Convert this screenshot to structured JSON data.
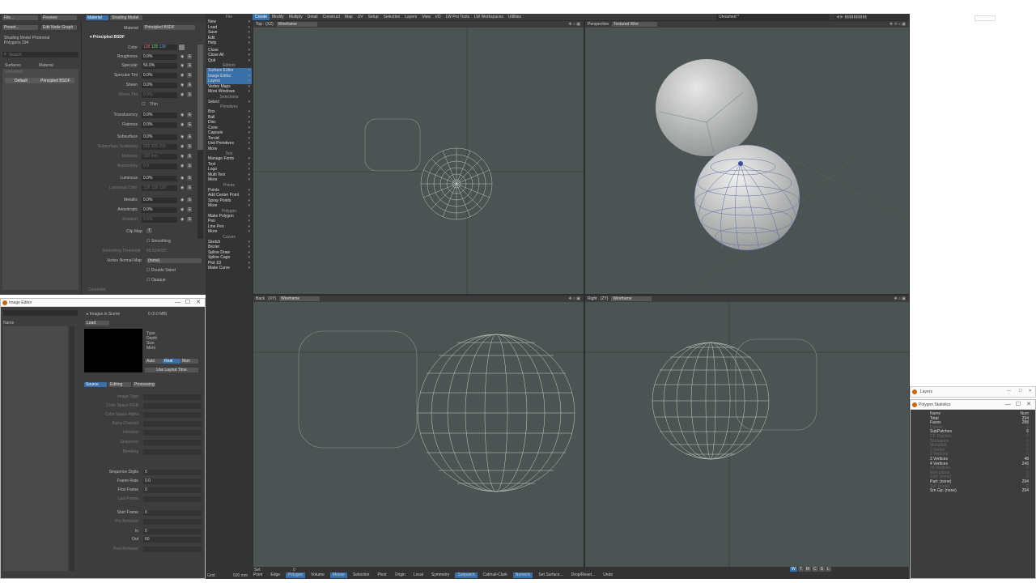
{
  "topbar": {
    "file_menu": "File...",
    "preview_menu": "Preview",
    "preset_menu": "Preset...",
    "edit_node_graph": "Edit Node Graph",
    "tab_material": "Material",
    "tab_shading": "Shading Model"
  },
  "surface_list": {
    "shading_model_label": "Shading Model",
    "shading_model_value": "Photoreal",
    "polygons_label": "Polygons",
    "polygons_value": "294",
    "search_placeholder": "Search",
    "col_surfaces": "Surfaces",
    "col_material": "Material",
    "group_name": "Unnamed",
    "row_surface": "Default",
    "row_material": "Principled BSDF"
  },
  "material": {
    "material_label": "Material",
    "material_value": "Principled BSDF",
    "section_title": "Principled BSDF",
    "color_label": "Color",
    "color_r": "128",
    "color_g": "128",
    "color_b": "128",
    "rows": [
      {
        "label": "Roughness",
        "value": "0.0%"
      },
      {
        "label": "Specular",
        "value": "50.0%"
      },
      {
        "label": "Specular Tint",
        "value": "0.0%"
      },
      {
        "label": "Sheen",
        "value": "0.0%"
      },
      {
        "label": "Sheen Tint",
        "value": "0.0%"
      },
      {
        "label": "Thin",
        "value": ""
      },
      {
        "label": "Translucency",
        "value": "0.0%"
      },
      {
        "label": "Flatness",
        "value": "0.0%"
      },
      {
        "label": "Subsurface",
        "value": "0.0%"
      },
      {
        "label": "Subsurface Scattering",
        "value": "255 255 255"
      },
      {
        "label": "Distance",
        "value": "100 mm"
      },
      {
        "label": "Asymmetry",
        "value": "0.0"
      },
      {
        "label": "Luminous",
        "value": "0.0%"
      },
      {
        "label": "Luminous Color",
        "value": "128 128 128"
      },
      {
        "label": "Metallic",
        "value": "0.0%"
      },
      {
        "label": "Anisotropic",
        "value": "0.0%"
      },
      {
        "label": "Rotation",
        "value": "0.0%"
      }
    ],
    "clip_map": "Clip Map",
    "clip_map_btn": "T",
    "smoothing": "Smoothing",
    "smoothing_threshold_label": "Smoothing Threshold",
    "smoothing_threshold_value": "89.524655°",
    "vertex_normal_label": "Vertex Normal Map",
    "vertex_normal_value": "(none)",
    "double_sided": "Double Sided",
    "opaque": "Opaque",
    "comment": "Comment"
  },
  "tool_menu": {
    "file_label": "File",
    "file_items": [
      "New",
      "Load",
      "Save",
      "Edit",
      "Help"
    ],
    "file_items2": [
      "Close",
      "Close All",
      "Quit"
    ],
    "editors_label": "Editors",
    "editor_items": [
      "Surface Editor",
      "Image Editor",
      "Layers",
      "Vertex Maps",
      "More Windows"
    ],
    "selections_label": "Selections",
    "select_item": "Select",
    "primitives_label": "Primitives",
    "primitive_items": [
      "Box",
      "Ball",
      "Disc",
      "Cone",
      "Capsule",
      "Toroid",
      "Unit Primitives",
      "More"
    ],
    "text_label": "Text",
    "text_items": [
      "Manage Fonts",
      "Text",
      "Logo",
      "Multi Text",
      "More"
    ],
    "points_label": "Points",
    "points_items": [
      "Points",
      "Add Center Point",
      "Spray Points",
      "More"
    ],
    "polygon_label": "Polygon",
    "polygon_items": [
      "Make Polygon",
      "Pen",
      "Line Pen",
      "More"
    ],
    "curves_label": "Curves",
    "curves_items": [
      "Sketch",
      "Bezier",
      "Spline Draw",
      "Spline Cage",
      "Plot 1D",
      "Make Curve"
    ]
  },
  "main_tabs": [
    "Create",
    "Modify",
    "Multiply",
    "Detail",
    "Construct",
    "Map",
    "UV",
    "Setup",
    "Selection",
    "Layers",
    "View",
    "I/O",
    "LW Pro Tools",
    "LW Workspaces",
    "Utilities"
  ],
  "object_name": "Unnamed *",
  "viewports": {
    "top": {
      "view": "Top",
      "axis": "(XZ)",
      "mode": "Wireframe"
    },
    "perspective": {
      "view": "Perspective",
      "mode": "Textured Wire"
    },
    "back": {
      "view": "Back",
      "axis": "(XY)",
      "mode": "Wireframe"
    },
    "right": {
      "view": "Right",
      "axis": "(ZY)",
      "mode": "Wireframe"
    }
  },
  "image_editor": {
    "title": "Image Editor",
    "images_in_scene": "Images in Scene",
    "memory": "0 (0.0 MB)",
    "col_name": "Name",
    "load_btn": "Load",
    "info_type": "Type",
    "info_depth": "Depth",
    "info_size": "Size",
    "info_mem": "Mem",
    "btn_auto": "Auto",
    "btn_real": "Real",
    "btn_man": "Man",
    "use_layout_time": "Use Layout Time",
    "tabs": [
      "Source",
      "Editing",
      "Processing"
    ],
    "fields": [
      "Image Type",
      "Color Space RGB",
      "Color Space Alpha",
      "Alpha Channel",
      "Interlace",
      "Sequence",
      "Blending",
      "Sequence Digits",
      "Frame Rate",
      "First Frame",
      "Last Frame",
      "Start Frame",
      "Pre Behavior",
      "In",
      "Out",
      "Post Behavior"
    ],
    "field_values": {
      "Sequence Digits": "0",
      "Frame Rate": "0.0",
      "First Frame": "0",
      "Start Frame": "0",
      "In": "0",
      "Out": "60"
    }
  },
  "layers_window": {
    "title": "Layers"
  },
  "poly_stats": {
    "title": "Polygon Statistics",
    "col_name": "Name",
    "col_num": "Num",
    "rows": [
      {
        "name": "Total",
        "num": "294",
        "hl": true
      },
      {
        "name": "Faces",
        "num": "288",
        "hl": true
      },
      {
        "name": "Curves",
        "num": "0",
        "hl": false
      },
      {
        "name": "SubPatches",
        "num": "6",
        "hl": true
      },
      {
        "name": "CC Patches",
        "num": "0",
        "hl": false
      },
      {
        "name": "Skelegons",
        "num": "0",
        "hl": false
      },
      {
        "name": "Metaballs",
        "num": "0",
        "hl": false
      },
      {
        "name": "1 Vertex",
        "num": "0",
        "hl": false
      },
      {
        "name": "2 Vertices",
        "num": "0",
        "hl": false
      },
      {
        "name": "3 Vertices",
        "num": "48",
        "hl": true
      },
      {
        "name": "4 Vertices",
        "num": "246",
        "hl": true
      },
      {
        "name": ">4 Vertices",
        "num": "0",
        "hl": false
      },
      {
        "name": "Non-planar",
        "num": "0",
        "hl": false
      },
      {
        "name": "Surf: (none)",
        "num": "0",
        "hl": false
      },
      {
        "name": "Part: (none)",
        "num": "294",
        "hl": true
      },
      {
        "name": "Sel: (none)",
        "num": "0",
        "hl": false
      },
      {
        "name": "Sm Gp: (none)",
        "num": "294",
        "hl": true
      }
    ]
  },
  "statusbar": {
    "sel_label": "Sel:",
    "sel_value": "0",
    "grid_label": "Grid:",
    "grid_value": "500 mm",
    "buttons": [
      "Point",
      "Edge",
      "Polygon",
      "Volume",
      "Mouse",
      "Selection",
      "Pivot",
      "Origin",
      "Local",
      "Symmetry",
      "Subpatch",
      "Catmull-Clark",
      "Numeric",
      "Set Surface...",
      "Drop/Reset...",
      "Undo"
    ],
    "right_buttons": [
      "W",
      "T",
      "M",
      "C",
      "S",
      "L"
    ]
  },
  "colors": {
    "accent": "#3a6fa8",
    "viewport_bg": "#4b5452",
    "panel_bg": "#3d3d3d"
  }
}
